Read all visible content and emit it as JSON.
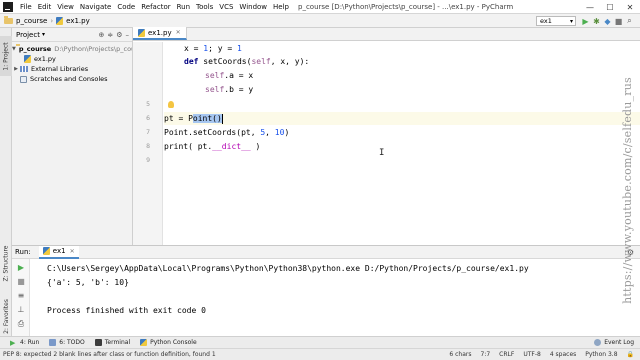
{
  "menubar": {
    "items": [
      "File",
      "Edit",
      "View",
      "Navigate",
      "Code",
      "Refactor",
      "Run",
      "Tools",
      "VCS",
      "Window",
      "Help"
    ],
    "title": "p_course [D:\\Python\\Projects\\p_course] - ...\\ex1.py - PyCharm"
  },
  "window_controls": {
    "minimize": "—",
    "maximize": "☐",
    "close": "✕"
  },
  "navbar": {
    "project": "p_course",
    "file": "ex1.py",
    "run_config": "ex1"
  },
  "side_tabs": {
    "project": "1: Project",
    "structure": "Z: Structure",
    "favorites": "2: Favorites"
  },
  "project_panel": {
    "header": "Project",
    "tree": [
      {
        "label": "p_course",
        "path": "D:\\Python\\Projects\\p_course"
      },
      {
        "label": "ex1.py"
      },
      {
        "label": "External Libraries"
      },
      {
        "label": "Scratches and Consoles"
      }
    ]
  },
  "editor": {
    "tab": "ex1.py",
    "line_numbers": [
      "",
      "",
      "",
      "",
      "5",
      "6",
      "7",
      "8",
      "9",
      "",
      "",
      "",
      "",
      "",
      ""
    ],
    "code": {
      "l1_a": "x = ",
      "l1_b": "1",
      "l1_c": "; y = ",
      "l1_d": "1",
      "l2_def": "def",
      "l2_name": " setCoords(",
      "l2_self": "self",
      "l2_rest": ", x, y):",
      "l3_self": "self",
      "l3_rest": ".a = x",
      "l4_self": "self",
      "l4_rest": ".b = y",
      "l6_a": "pt = P",
      "l6_sel": "oint()",
      "l7_a": "Point.setCoords(pt, ",
      "l7_n1": "5",
      "l7_b": ", ",
      "l7_n2": "10",
      "l7_c": ")",
      "l8_a": "print( pt.",
      "l8_d": "__dict__",
      "l8_b": " )"
    }
  },
  "run_panel": {
    "label": "Run:",
    "tab": "ex1",
    "console": [
      "C:\\Users\\Sergey\\AppData\\Local\\Programs\\Python\\Python38\\python.exe D:/Python/Projects/p_course/ex1.py",
      "{'a': 5, 'b': 10}",
      "",
      "Process finished with exit code 0"
    ]
  },
  "bottom_tabs": {
    "run": "4: Run",
    "todo": "6: TODO",
    "terminal": "Terminal",
    "python_console": "Python Console",
    "event_log": "Event Log"
  },
  "statusbar": {
    "message": "PEP 8: expected 2 blank lines after class or function definition, found 1",
    "chars": "6 chars",
    "position": "7:7",
    "line_sep": "CRLF",
    "encoding": "UTF-8",
    "indent": "4 spaces",
    "interpreter": "Python 3.8"
  },
  "watermark": "https://www.youtube.com/c/selfedu_rus"
}
